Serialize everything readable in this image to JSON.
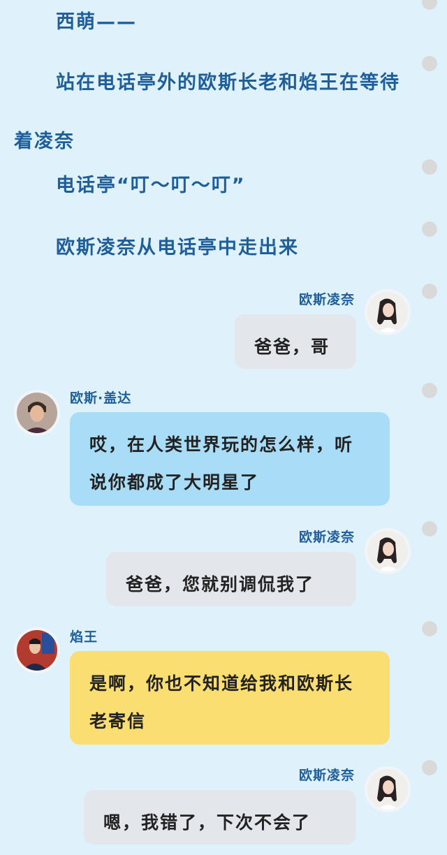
{
  "narration": [
    "西萌——",
    "站在电话亭外的欧斯长老和焰王在等待着凌奈",
    "电话亭“叮～叮～叮”",
    "欧斯凌奈从电话亭中走出来"
  ],
  "messages": [
    {
      "sender": "欧斯凌奈",
      "side": "right",
      "style": "gray",
      "text": "爸爸，哥"
    },
    {
      "sender": "欧斯·盖达",
      "side": "left",
      "style": "blue",
      "text": "哎，在人类世界玩的怎么样，听说你都成了大明星了"
    },
    {
      "sender": "欧斯凌奈",
      "side": "right",
      "style": "gray",
      "text": "爸爸，您就别调侃我了"
    },
    {
      "sender": "焰王",
      "side": "left",
      "style": "yellow",
      "text": "是啊，你也不知道给我和欧斯长老寄信"
    },
    {
      "sender": "欧斯凌奈",
      "side": "right",
      "style": "gray",
      "text": "嗯，我错了，下次不会了"
    }
  ],
  "avatars": {
    "lingnai": "portrait-girl",
    "gaida": "portrait-man",
    "yanwang": "portrait-performer"
  },
  "colors": {
    "background": "#dff2fb",
    "name_text": "#1f5e99",
    "bubble_gray": "#e3e6ea",
    "bubble_blue": "#a9dcf6",
    "bubble_yellow": "#fbde71"
  }
}
